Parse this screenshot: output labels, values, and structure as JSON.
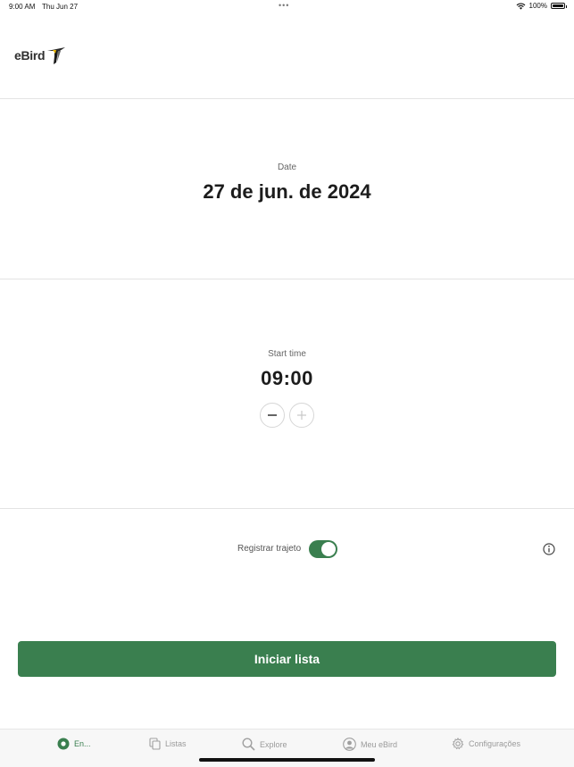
{
  "status_bar": {
    "time": "9:00 AM",
    "date": "Thu Jun 27",
    "battery": "100%",
    "icons": [
      "wifi-icon",
      "battery-icon"
    ]
  },
  "app": {
    "logo_text": "eBird",
    "accent_color": "#3a7f4f"
  },
  "date_section": {
    "label": "Date",
    "value": "27 de jun. de 2024"
  },
  "time_section": {
    "label": "Start time",
    "value": "09:00",
    "decrement_icon": "minus-icon",
    "increment_icon": "plus-icon"
  },
  "track": {
    "label": "Registrar trajeto",
    "enabled": true,
    "info_icon": "info-icon"
  },
  "primary_action": {
    "label": "Iniciar lista"
  },
  "tabs": [
    {
      "label": "En...",
      "icon": "record-icon",
      "active": true
    },
    {
      "label": "Listas",
      "icon": "copy-icon",
      "active": false
    },
    {
      "label": "Explore",
      "icon": "search-icon",
      "active": false
    },
    {
      "label": "Meu eBird",
      "icon": "profile-icon",
      "active": false
    },
    {
      "label": "Configurações",
      "icon": "gear-icon",
      "active": false
    }
  ]
}
